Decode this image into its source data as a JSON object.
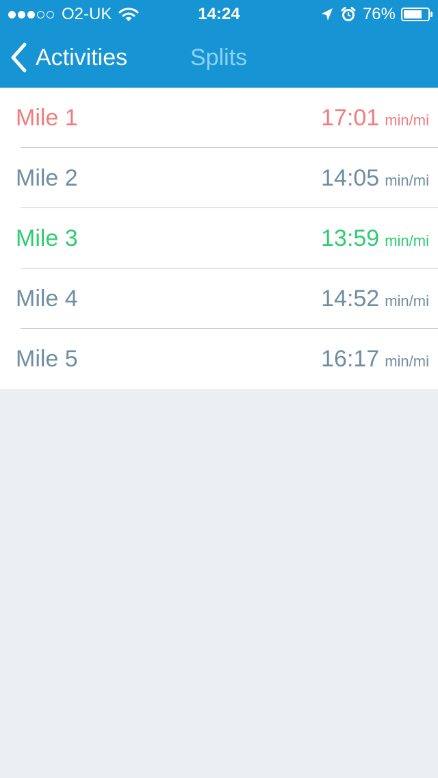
{
  "status_bar": {
    "signal_bars_filled": 3,
    "signal_bars_total": 5,
    "carrier": "O2-UK",
    "wifi_icon": "wifi-icon",
    "time": "14:24",
    "location_icon": "location-arrow-icon",
    "alarm_icon": "alarm-clock-icon",
    "battery_percent": "76%",
    "battery_level": 0.76
  },
  "nav": {
    "back_label": "Activities",
    "title": "Splits"
  },
  "colors": {
    "nav_background": "#1694d4",
    "title_color": "#8fd3f3",
    "slowest": "#f27b7b",
    "fastest": "#2ecc71",
    "normal": "#6f8da3",
    "background": "#ebeff2"
  },
  "splits": [
    {
      "label": "Mile 1",
      "time": "17:01",
      "unit": "min/mi",
      "status": "slowest"
    },
    {
      "label": "Mile 2",
      "time": "14:05",
      "unit": "min/mi",
      "status": "normal"
    },
    {
      "label": "Mile 3",
      "time": "13:59",
      "unit": "min/mi",
      "status": "fastest"
    },
    {
      "label": "Mile 4",
      "time": "14:52",
      "unit": "min/mi",
      "status": "normal"
    },
    {
      "label": "Mile 5",
      "time": "16:17",
      "unit": "min/mi",
      "status": "normal"
    }
  ]
}
